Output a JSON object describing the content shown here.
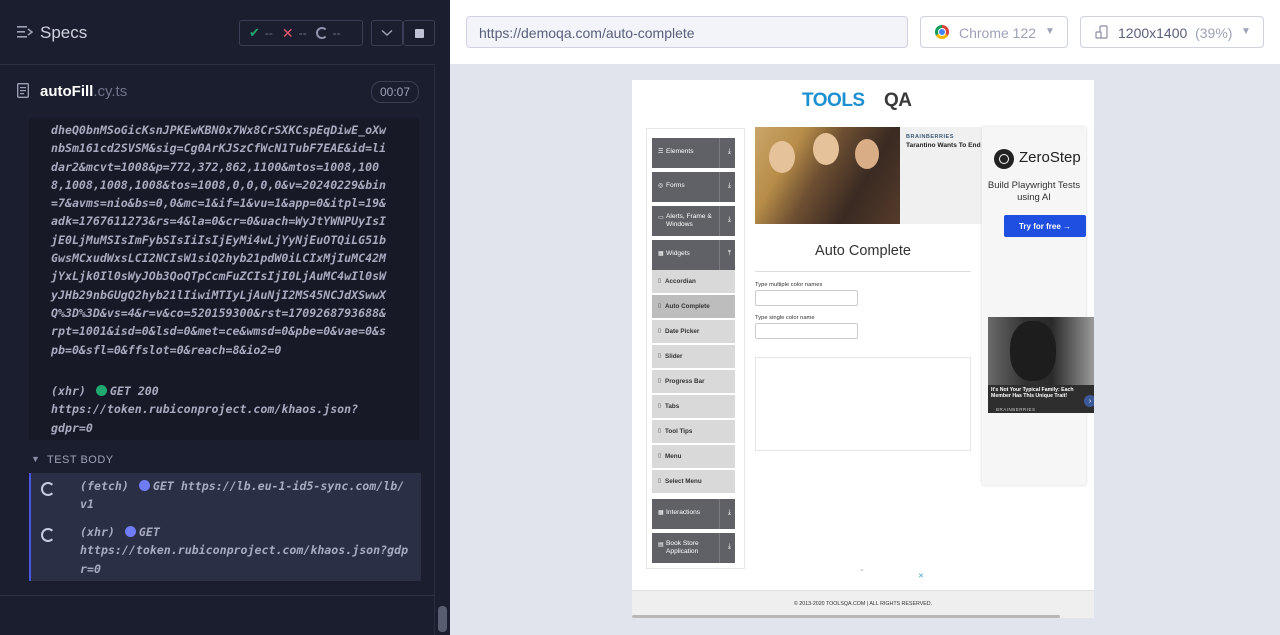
{
  "runner": {
    "title": "Specs",
    "stats": {
      "passed": "--",
      "failed": "--",
      "pending": "--"
    },
    "spec": {
      "name": "autoFill",
      "ext": ".cy.ts",
      "timer": "00:07"
    },
    "log_text": "dheQ0bnMSoGicKsnJPKEwKBN0x7Wx8CrSXKCspEqDiwE_oXwnbSm161cd2SVSM&sig=Cg0ArKJSzCfWcN1TubF7EAE&id=lidar2&mcvt=1008&p=772,372,862,1100&mtos=1008,1008,1008,1008,1008&tos=1008,0,0,0,0&v=20240229&bin=7&avms=nio&bs=0,0&mc=1&if=1&vu=1&app=0&itpl=19&adk=1767611273&rs=4&la=0&cr=0&uach=WyJtYWNPUyIsIjE0LjMuMSIsImFybSIsIiIsIjEyMi4wLjYyNjEuOTQiLG51bGwsMCxudWxsLCI2NCIsW1siQ2hyb21pdW0iLCIxMjIuMC42MjYxLjk0Il0sWyJOb3QoQTpCcmFuZCIsIjI0LjAuMC4wIl0sWyJHb29nbGUgQ2hyb21lIiwiMTIyLjAuNjI2MS45NCJdXSwwXQ%3D%3D&vs=4&r=v&co=520159300&rst=1709268793688&rpt=1001&isd=0&lsd=0&met=ce&wmsd=0&pbe=0&vae=0&spb=0&sfl=0&ffslot=0&reach=8&io2=0",
    "xhr_prefix": "(xhr)",
    "xhr_method": "GET 200",
    "xhr_url": "https://token.rubiconproject.com/khaos.json?gdpr=0",
    "test_body_label": "TEST BODY",
    "commands": [
      {
        "prefix": "(fetch)",
        "method": "GET",
        "url": "https://lb.eu-1-id5-sync.com/lb/v1"
      },
      {
        "prefix": "(xhr)",
        "method": "GET",
        "url": "https://token.rubiconproject.com/khaos.json?gdpr=0"
      }
    ]
  },
  "aut": {
    "url": "https://demoqa.com/auto-complete",
    "browser": "Chrome 122",
    "viewport": "1200x1400",
    "scale": "(39%)"
  },
  "page": {
    "logo_tools": "TOOLS",
    "logo_qa": "QA",
    "menu_groups": [
      {
        "label": "Elements"
      },
      {
        "label": "Forms"
      },
      {
        "label": "Alerts, Frame & Windows"
      },
      {
        "label": "Widgets"
      },
      {
        "label": "Interactions"
      },
      {
        "label": "Book Store Application"
      }
    ],
    "widget_items": [
      "Accordian",
      "Auto Complete",
      "Date Picker",
      "Slider",
      "Progress Bar",
      "Tabs",
      "Tool Tips",
      "Menu",
      "Select Menu"
    ],
    "ad_brand": "BRAINBERRIES",
    "ad_headline": "Tarantino Wants To End",
    "title": "Auto Complete",
    "label_multiple": "Type multiple color names",
    "label_single": "Type single color name",
    "zerostep_name": "ZeroStep",
    "zerostep_text": "Build Playwright Tests using AI",
    "zerostep_btn": "Try for free →",
    "ad2_headline": "It's Not Your Typical Family: Each Member Has This Unique Trait!",
    "ad2_brand": "BRAINBERRIES",
    "footer": "© 2013-2020 TOOLSQA.COM | ALL RIGHTS RESERVED."
  },
  "colors": {
    "runner_bg": "#1b1e2e",
    "accent": "#4956e3",
    "pass": "#1fa971",
    "fail": "#e45770",
    "toolsqa_blue": "#1d90d1"
  }
}
